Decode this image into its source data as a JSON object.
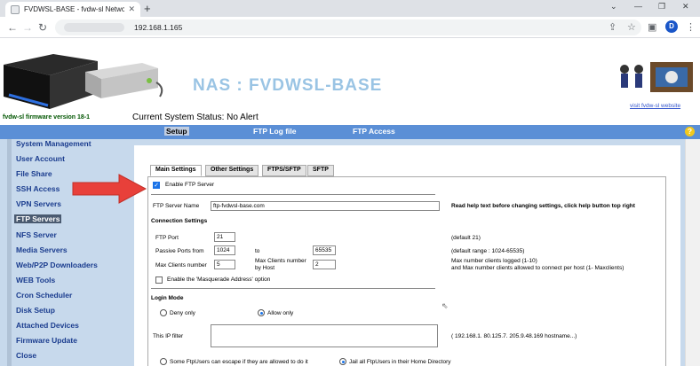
{
  "browser": {
    "tab_title": "FVDWSL-BASE - fvdw-sl Network",
    "url": "192.168.1.165",
    "profile_initial": "D"
  },
  "header": {
    "title": "NAS : FVDWSL-BASE",
    "visit_link": "visit fvdw-sl website",
    "firmware": "fvdw-sl firmware version 18-1",
    "system_status": "Current System Status:  No Alert"
  },
  "topnav": {
    "items": [
      "Setup",
      "FTP Log file",
      "FTP Access"
    ],
    "active": "Setup"
  },
  "sidebar": {
    "items": [
      "System Management",
      "User Account",
      "File Share",
      "SSH Access",
      "VPN Servers",
      "FTP Servers",
      "NFS Server",
      "Media Servers",
      "Web/P2P Downloaders",
      "WEB Tools",
      "Cron Scheduler",
      "Disk Setup",
      "Attached Devices",
      "Firmware Update",
      "Close"
    ],
    "active": "FTP Servers"
  },
  "subtabs": [
    "Main Settings",
    "Other Settings",
    "FTPS/SFTP",
    "SFTP"
  ],
  "form": {
    "enable_ftp_label": "Enable FTP Server",
    "enable_ftp_checked": true,
    "server_name_label": "FTP Server Name",
    "server_name_value": "ftp-fvdwsl-base.com",
    "help_text": "Read help text before changing settings, click help button top right",
    "connection_settings": "Connection Settings",
    "ftp_port_label": "FTP Port",
    "ftp_port_value": "21",
    "ftp_port_hint": "(default 21)",
    "passive_ports_label": "Passive Ports from",
    "passive_from": "1024",
    "to_label": "to",
    "passive_to": "65535",
    "passive_hint": "(default range : 1024-65535)",
    "max_clients_label": "Max Clients number",
    "max_clients_value": "5",
    "max_per_host_label_1": "Max Clients number",
    "max_per_host_label_2": "by Host",
    "max_per_host_value": "2",
    "max_hint_1": "Max number clients logged (1-10)",
    "max_hint_2": "and Max number clients allowed to connect per host (1- Maxclients)",
    "masquerade_label": "Enable the 'Masquerade Address' option",
    "login_mode": "Login Mode",
    "deny_only": "Deny only",
    "allow_only": "Allow only",
    "ip_filter_label": "This IP filter",
    "ip_filter_hint": "( 192.168.1.    80.125.7.    205.9.48.169    hostname...)",
    "escape_label": "Some FtpUsers can escape if they are allowed to do it",
    "jail_label": "Jail all FtpUsers in their Home Directory"
  }
}
